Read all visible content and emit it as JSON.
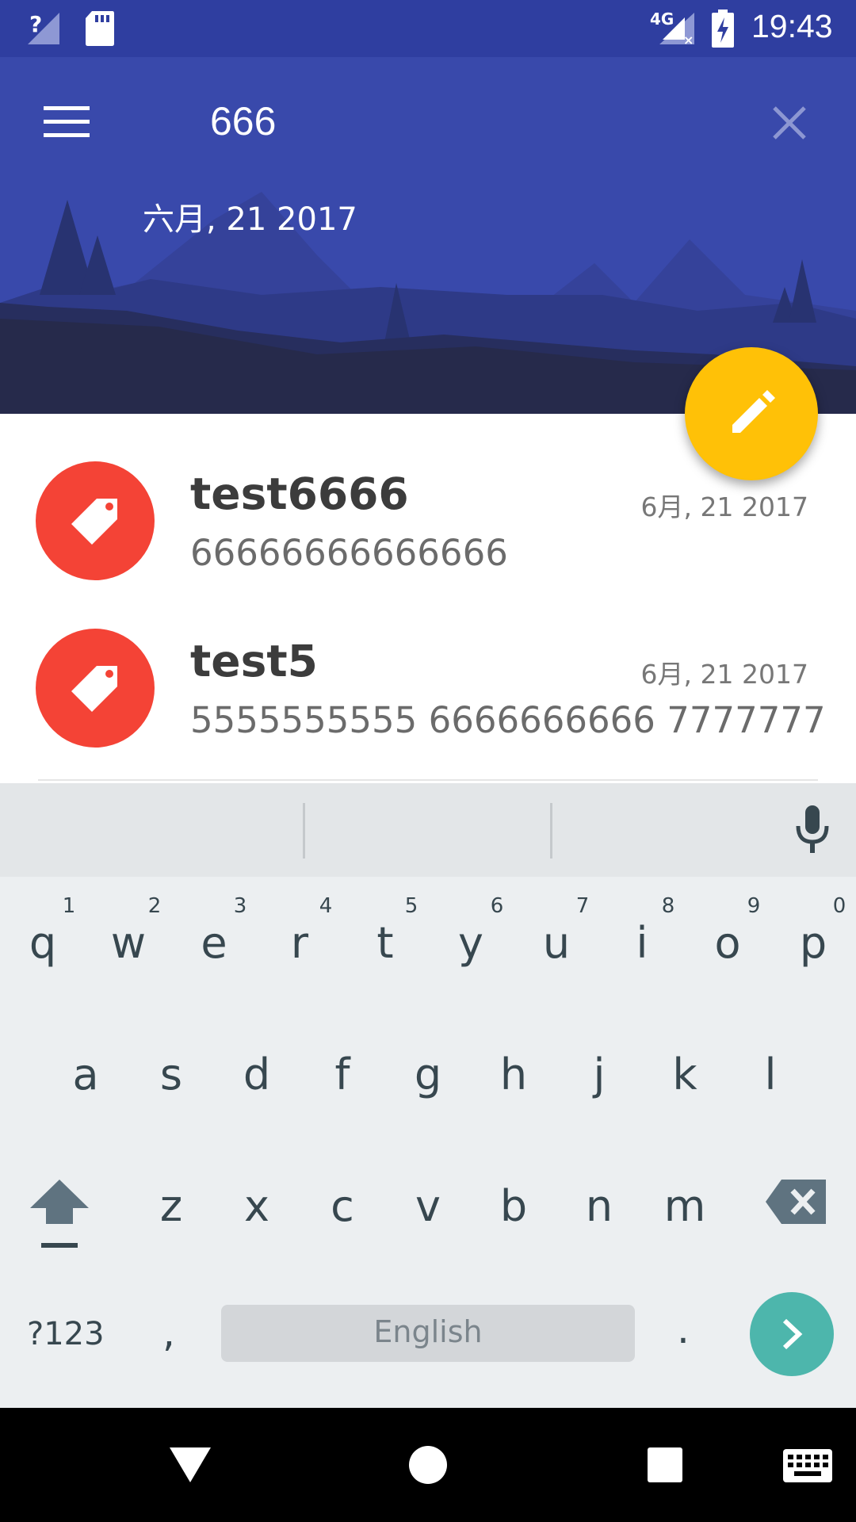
{
  "status_bar": {
    "time": "19:43",
    "network": "4G"
  },
  "toolbar": {
    "search_text": "666",
    "date_label": "六月, 21 2017",
    "menu_icon": "menu-icon",
    "close_icon": "close-icon"
  },
  "fab": {
    "icon": "pencil-icon",
    "color": "#ffc107"
  },
  "notes": [
    {
      "title": "test6666",
      "date": "6月, 21 2017",
      "body": "66666666666666",
      "icon": "tag-icon"
    },
    {
      "title": "test5",
      "date": "6月, 21 2017",
      "body": "5555555555 6666666666 7777777",
      "icon": "tag-icon"
    }
  ],
  "keyboard": {
    "row1": [
      {
        "k": "q",
        "h": "1"
      },
      {
        "k": "w",
        "h": "2"
      },
      {
        "k": "e",
        "h": "3"
      },
      {
        "k": "r",
        "h": "4"
      },
      {
        "k": "t",
        "h": "5"
      },
      {
        "k": "y",
        "h": "6"
      },
      {
        "k": "u",
        "h": "7"
      },
      {
        "k": "i",
        "h": "8"
      },
      {
        "k": "o",
        "h": "9"
      },
      {
        "k": "p",
        "h": "0"
      }
    ],
    "row2": [
      "a",
      "s",
      "d",
      "f",
      "g",
      "h",
      "j",
      "k",
      "l"
    ],
    "row3": [
      "z",
      "x",
      "c",
      "v",
      "b",
      "n",
      "m"
    ],
    "symbols_key": "?123",
    "comma_key": ",",
    "space_label": "English",
    "period_key": ".",
    "accent_color": "#4db6ac"
  },
  "nav_bar": {
    "back": "back-icon",
    "home": "home-icon",
    "recents": "recents-icon",
    "keyboard": "keyboard-icon"
  }
}
